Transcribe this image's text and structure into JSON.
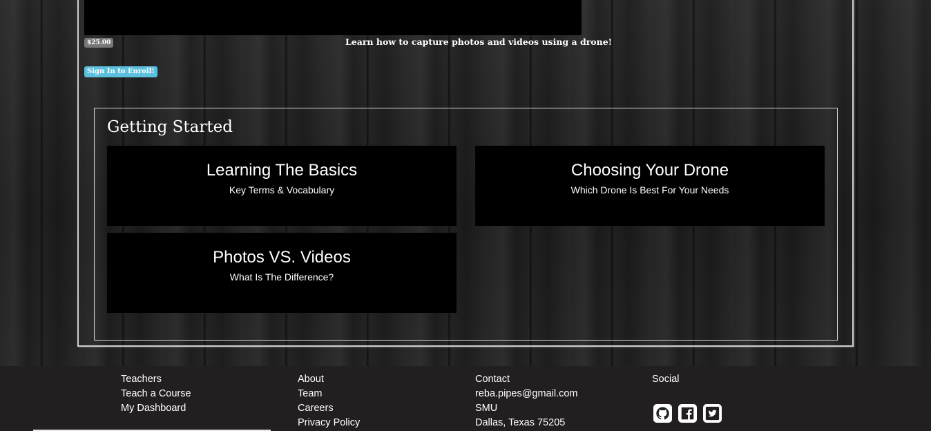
{
  "course": {
    "price": "$25.00",
    "description": "Learn how to capture photos and videos using a drone!",
    "enroll_label": "Sign In to Enroll!"
  },
  "getting_started": {
    "title": "Getting Started",
    "cards": [
      {
        "title": "Learning The Basics",
        "subtitle": "Key Terms & Vocabulary"
      },
      {
        "title": "Choosing Your Drone",
        "subtitle": "Which Drone Is Best For Your Needs"
      },
      {
        "title": "Photos VS. Videos",
        "subtitle": "What Is The Difference?"
      }
    ]
  },
  "footer": {
    "teachers": {
      "heading": "Teachers",
      "links": [
        "Teach a Course",
        "My Dashboard"
      ]
    },
    "about": {
      "heading": "About",
      "links": [
        "Team",
        "Careers",
        "Privacy Policy"
      ]
    },
    "contact": {
      "heading": "Contact",
      "lines": [
        "reba.pipes@gmail.com",
        "SMU",
        "Dallas, Texas 75205"
      ]
    },
    "social": {
      "heading": "Social",
      "icons": [
        "github-icon",
        "facebook-icon",
        "twitter-icon"
      ]
    }
  },
  "colors": {
    "enroll_button": "#5bc0de",
    "price_badge": "#777777",
    "footer_bg": "#231f20"
  }
}
